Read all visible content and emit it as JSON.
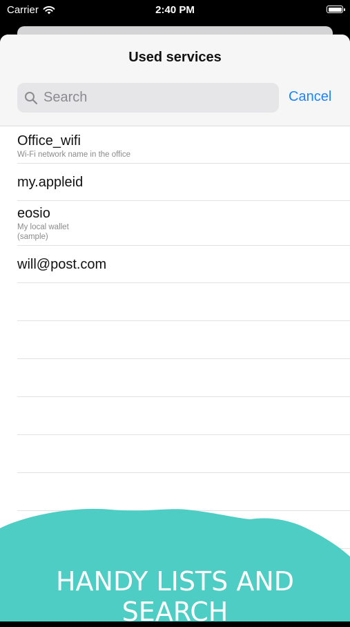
{
  "status": {
    "carrier": "Carrier",
    "time": "2:40 PM"
  },
  "sheet": {
    "title": "Used services"
  },
  "search": {
    "placeholder": "Search",
    "cancel_label": "Cancel"
  },
  "items": [
    {
      "title": "Office_wifi",
      "subtitle_lines": [
        "Wi-Fi network name in the office"
      ]
    },
    {
      "title": "my.appleid",
      "subtitle_lines": []
    },
    {
      "title": "eosio",
      "subtitle_lines": [
        "My local wallet",
        "(sample)"
      ]
    },
    {
      "title": "will@post.com",
      "subtitle_lines": []
    }
  ],
  "banner": {
    "text": "HANDY LISTS AND SEARCH",
    "color": "#4ecdc4"
  },
  "colors": {
    "accent": "#1a84ff"
  }
}
